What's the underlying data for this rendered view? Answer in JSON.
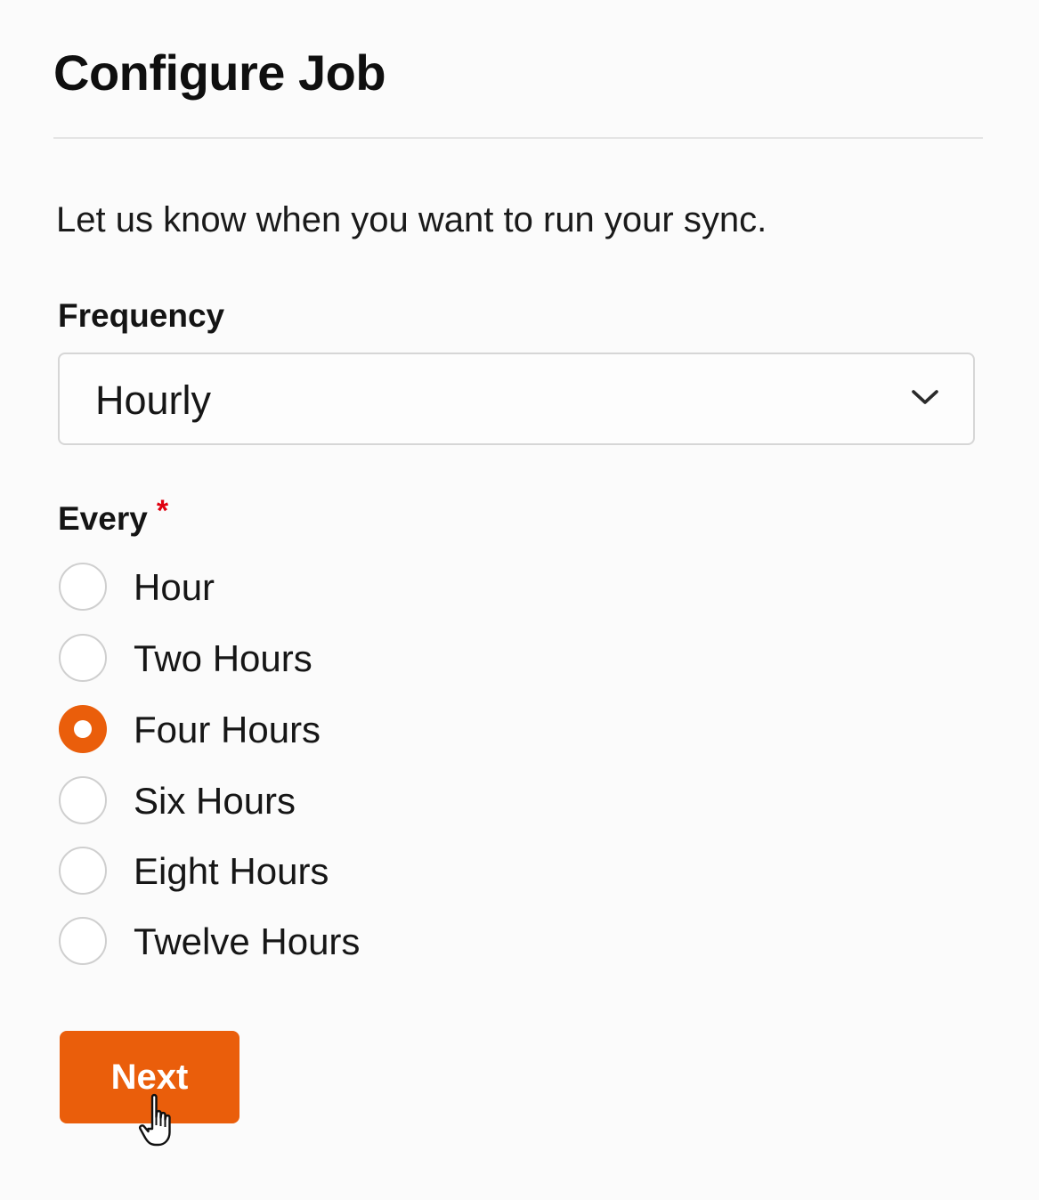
{
  "header": {
    "title": "Configure Job"
  },
  "intro_text": "Let us know when you want to run your sync.",
  "frequency": {
    "label": "Frequency",
    "selected_value": "Hourly",
    "icon": "chevron-down-icon"
  },
  "every": {
    "label": "Every",
    "required_marker": "*",
    "options": [
      {
        "label": "Hour",
        "checked": false
      },
      {
        "label": "Two Hours",
        "checked": false
      },
      {
        "label": "Four Hours",
        "checked": true
      },
      {
        "label": "Six Hours",
        "checked": false
      },
      {
        "label": "Eight Hours",
        "checked": false
      },
      {
        "label": "Twelve Hours",
        "checked": false
      }
    ]
  },
  "actions": {
    "next_label": "Next"
  },
  "colors": {
    "accent": "#ea5e0b",
    "required": "#e0000f",
    "border": "#d6d6d6"
  },
  "cursor": {
    "icon": "hand-pointer-icon"
  }
}
